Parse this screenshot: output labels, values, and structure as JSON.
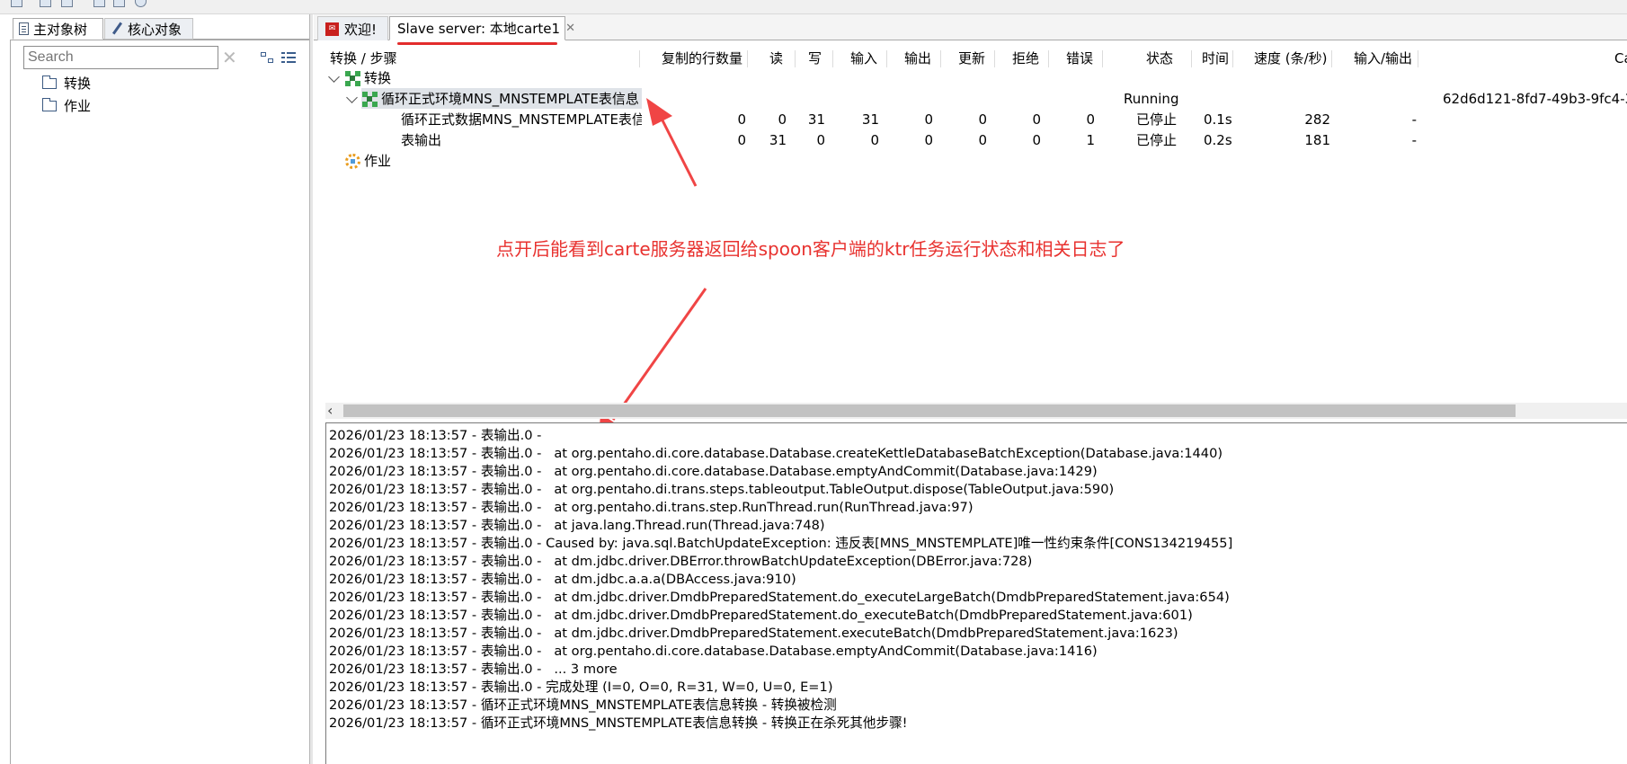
{
  "left_panel": {
    "tabs": [
      "主对象树",
      "核心对象"
    ],
    "search": {
      "placeholder": "Search"
    },
    "tree": [
      "转换",
      "作业"
    ]
  },
  "tabs": [
    {
      "label": "欢迎!",
      "icon": "spoon-icon"
    },
    {
      "label": "Slave server: 本地carte1",
      "icon": null,
      "closable": true
    }
  ],
  "grid": {
    "columns": [
      "转换 / 步骤",
      "复制的行数量",
      "读",
      "写",
      "输入",
      "输出",
      "更新",
      "拒绝",
      "错误",
      "状态",
      "时间",
      "速度 (条/秒)",
      "输入/输出",
      "Ca"
    ],
    "root_transform": "转换",
    "transformation": {
      "name": "循环正式环境MNS_MNSTEMPLATE表信息",
      "status": "Running",
      "id": "62d6d121-8fd7-49b3-9fc4-3"
    },
    "steps": [
      {
        "name": "循环正式数据MNS_MNSTEMPLATE表信",
        "copies": "0",
        "read": "0",
        "written": "31",
        "input": "31",
        "output": "0",
        "updated": "0",
        "rejected": "0",
        "errors": "0",
        "status": "已停止",
        "time": "0.1s",
        "speed": "282",
        "io": "-"
      },
      {
        "name": "表输出",
        "copies": "0",
        "read": "31",
        "written": "0",
        "input": "0",
        "output": "0",
        "updated": "0",
        "rejected": "0",
        "errors": "1",
        "status": "已停止",
        "time": "0.2s",
        "speed": "181",
        "io": "-"
      }
    ],
    "root_job": "作业"
  },
  "annotation": "点开后能看到carte服务器返回给spoon客户端的ktr任务运行状态和相关日志了",
  "log_lines": [
    "2026/01/23 18:13:57 - 表输出.0 -",
    "2026/01/23 18:13:57 - 表输出.0 -   at org.pentaho.di.core.database.Database.createKettleDatabaseBatchException(Database.java:1440)",
    "2026/01/23 18:13:57 - 表输出.0 -   at org.pentaho.di.core.database.Database.emptyAndCommit(Database.java:1429)",
    "2026/01/23 18:13:57 - 表输出.0 -   at org.pentaho.di.trans.steps.tableoutput.TableOutput.dispose(TableOutput.java:590)",
    "2026/01/23 18:13:57 - 表输出.0 -   at org.pentaho.di.trans.step.RunThread.run(RunThread.java:97)",
    "2026/01/23 18:13:57 - 表输出.0 -   at java.lang.Thread.run(Thread.java:748)",
    "2026/01/23 18:13:57 - 表输出.0 - Caused by: java.sql.BatchUpdateException: 违反表[MNS_MNSTEMPLATE]唯一性约束条件[CONS134219455]",
    "2026/01/23 18:13:57 - 表输出.0 -   at dm.jdbc.driver.DBError.throwBatchUpdateException(DBError.java:728)",
    "2026/01/23 18:13:57 - 表输出.0 -   at dm.jdbc.a.a.a(DBAccess.java:910)",
    "2026/01/23 18:13:57 - 表输出.0 -   at dm.jdbc.driver.DmdbPreparedStatement.do_executeLargeBatch(DmdbPreparedStatement.java:654)",
    "2026/01/23 18:13:57 - 表输出.0 -   at dm.jdbc.driver.DmdbPreparedStatement.do_executeBatch(DmdbPreparedStatement.java:601)",
    "2026/01/23 18:13:57 - 表输出.0 -   at dm.jdbc.driver.DmdbPreparedStatement.executeBatch(DmdbPreparedStatement.java:1623)",
    "2026/01/23 18:13:57 - 表输出.0 -   at org.pentaho.di.core.database.Database.emptyAndCommit(Database.java:1416)",
    "2026/01/23 18:13:57 - 表输出.0 -   ... 3 more",
    "2026/01/23 18:13:57 - 表输出.0 - 完成处理 (I=0, O=0, R=31, W=0, U=0, E=1)",
    "2026/01/23 18:13:57 - 循环正式环境MNS_MNSTEMPLATE表信息转换 - 转换被检测",
    "2026/01/23 18:13:57 - 循环正式环境MNS_MNSTEMPLATE表信息转换 - 转换正在杀死其他步骤!"
  ],
  "colors": {
    "annotation": "#e8322f",
    "selection": "#dfe3e8",
    "trans_icon": "#3aa74f"
  }
}
